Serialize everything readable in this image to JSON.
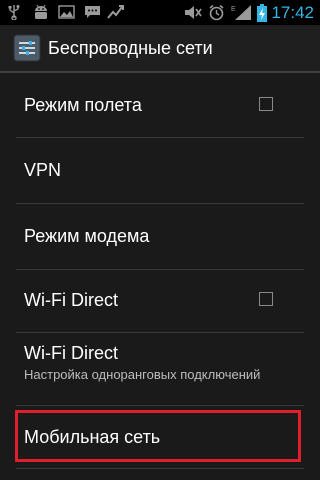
{
  "status_bar": {
    "time": "17:42",
    "icons": [
      "usb-icon",
      "android-debug-icon",
      "image-icon",
      "chat-icon",
      "signal-activity-icon",
      "mute-icon",
      "alarm-icon",
      "signal-icon",
      "battery-icon"
    ]
  },
  "action_bar": {
    "title": "Беспроводные сети",
    "icon": "settings-icon"
  },
  "list": {
    "items": [
      {
        "title": "Режим полета",
        "has_checkbox": true,
        "checked": false
      },
      {
        "title": "VPN"
      },
      {
        "title": "Режим модема"
      },
      {
        "title": "Wi-Fi Direct",
        "has_checkbox": true,
        "checked": false
      },
      {
        "title": "Wi-Fi Direct",
        "subtitle": "Настройка одноранговых подключений"
      },
      {
        "title": "Мобильная сеть",
        "highlighted": true
      }
    ]
  },
  "colors": {
    "accent": "#35b5e5",
    "highlight": "#e01f2d"
  }
}
